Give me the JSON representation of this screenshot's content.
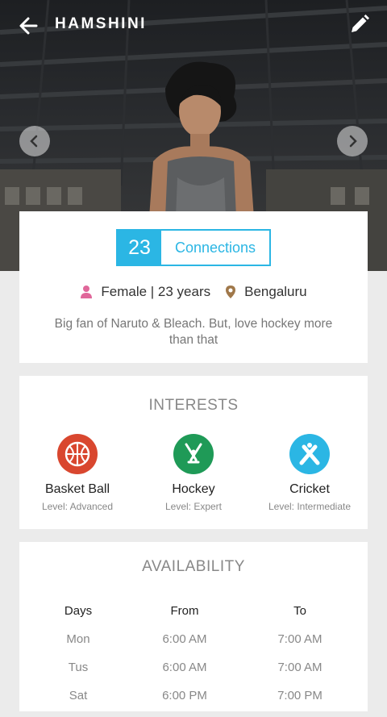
{
  "header": {
    "title": "HAMSHINI"
  },
  "icons": {
    "back": "arrow-left-icon",
    "edit": "pencil-icon",
    "prev": "chevron-left-icon",
    "next": "chevron-right-icon",
    "gender": "person-icon",
    "location": "location-pin-icon"
  },
  "profile": {
    "connections_count": "23",
    "connections_label": "Connections",
    "gender_age": "Female | 23 years",
    "location": "Bengaluru",
    "bio": "Big fan of Naruto & Bleach. But, love hockey more than that"
  },
  "interests": {
    "title": "INTERESTS",
    "items": [
      {
        "name": "Basket Ball",
        "level": "Level: Advanced",
        "icon": "basketball-icon",
        "color": "#d9472f"
      },
      {
        "name": "Hockey",
        "level": "Level: Expert",
        "icon": "hockey-icon",
        "color": "#1f9a57"
      },
      {
        "name": "Cricket",
        "level": "Level: Intermediate",
        "icon": "cricket-icon",
        "color": "#2bb6e4"
      }
    ]
  },
  "availability": {
    "title": "AVAILABILITY",
    "headers": [
      "Days",
      "From",
      "To"
    ],
    "rows": [
      [
        "Mon",
        "6:00 AM",
        "7:00 AM"
      ],
      [
        "Tus",
        "6:00 AM",
        "7:00 AM"
      ],
      [
        "Sat",
        "6:00 PM",
        "7:00 PM"
      ]
    ]
  },
  "colors": {
    "accent": "#2bb6e4",
    "gender_icon": "#e0679a",
    "location_icon": "#a0784a"
  }
}
